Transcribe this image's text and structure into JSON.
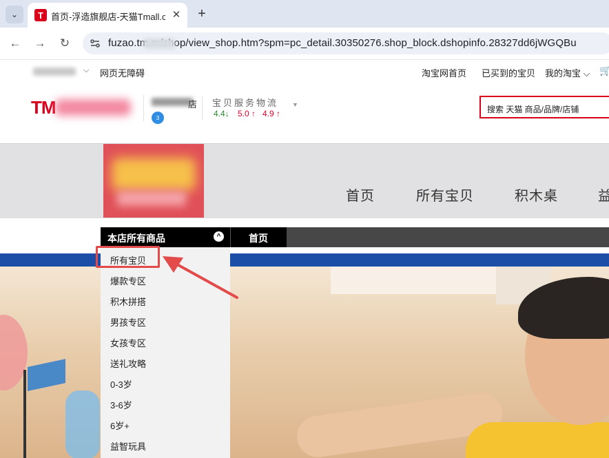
{
  "browser": {
    "tab_title": "首页-浮造旗舰店-天猫Tmall.com",
    "tab_favicon_letter": "T",
    "tab_close": "✕",
    "new_tab": "+",
    "url": "fuzao.tm        m/shop/view_shop.htm?spm=pc_detail.30350276.shop_block.dshopinfo.28327dd6jWGQBu",
    "back": "←",
    "forward": "→",
    "reload": "↻",
    "tab_menu": "⌄"
  },
  "topbar": {
    "user_chevron": "⌵",
    "accessible": "网页无障碍",
    "taobao_home": "淘宝网首页",
    "bought": "已买到的宝贝",
    "my_taobao": "我的淘宝 ⌵",
    "cart_icon": "🛒"
  },
  "header": {
    "logo_text": "TM",
    "shop_name_tail": "店",
    "shop_badge": "3",
    "rating_labels": "宝贝服务物流",
    "ratings": [
      {
        "value": "4.4",
        "arrow": "↓",
        "color": "#2a8a2a"
      },
      {
        "value": "5.0",
        "arrow": "↑",
        "color": "#e4002b"
      },
      {
        "value": "4.9",
        "arrow": "↑",
        "color": "#e4002b"
      }
    ],
    "rating_chevron": "▼",
    "search_placeholder": "搜索 天猫 商品/品牌/店铺"
  },
  "banner": {
    "nav": [
      "首页",
      "所有宝贝",
      "积木桌",
      "益"
    ]
  },
  "category_bar": {
    "all_label": "本店所有商品",
    "toggle": "^",
    "home_label": "首页"
  },
  "dropdown": {
    "items": [
      "所有宝贝",
      "爆款专区",
      "积木拼搭",
      "男孩专区",
      "女孩专区",
      "送礼攻略",
      "0-3岁",
      "3-6岁",
      "6岁+",
      "益智玩具"
    ]
  },
  "colors": {
    "tmall_red": "#d9001b",
    "annotation_red": "#e34a4a",
    "blue_strip": "#1b4ea6"
  }
}
